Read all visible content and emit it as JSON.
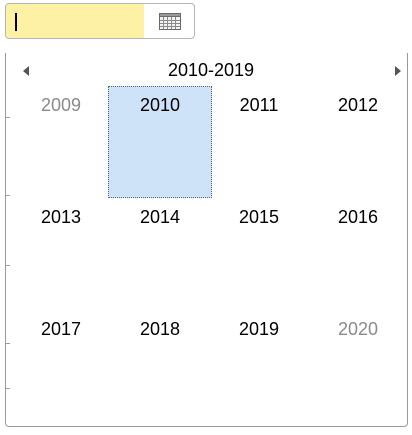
{
  "date_input": {
    "value": "",
    "calendar_icon": "calendar-icon"
  },
  "calendar": {
    "nav": {
      "prev_icon": "triangle-left-icon",
      "next_icon": "triangle-right-icon",
      "title": "2010-2019"
    },
    "rows": [
      [
        "2009",
        "2010",
        "2011",
        "2012"
      ],
      [
        "2013",
        "2014",
        "2015",
        "2016"
      ],
      [
        "2017",
        "2018",
        "2019",
        "2020"
      ]
    ],
    "selected": "2010",
    "colors": {
      "input_bg": "#fdf1a5",
      "selected_bg": "#cfe3f8",
      "selected_border": "#2e8b2e",
      "out_of_range_text": "#8a8a8a"
    }
  }
}
